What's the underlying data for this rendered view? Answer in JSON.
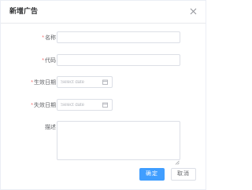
{
  "dialog": {
    "title": "新增广告"
  },
  "form": {
    "name": {
      "required_mark": "*",
      "label": "名称",
      "value": ""
    },
    "code": {
      "required_mark": "*",
      "label": "代码",
      "value": ""
    },
    "start_date": {
      "required_mark": "*",
      "label": "生效日期",
      "placeholder": "Select date"
    },
    "end_date": {
      "required_mark": "*",
      "label": "失效日期",
      "placeholder": "Select date"
    },
    "remark": {
      "label": "描述",
      "value": ""
    }
  },
  "footer": {
    "confirm_label": "确定",
    "cancel_label": "取消"
  },
  "colors": {
    "primary": "#409eff",
    "required": "#f56c6c",
    "border": "#dcdfe6"
  },
  "icons": {
    "close": "close-icon",
    "calendar": "calendar-icon"
  }
}
